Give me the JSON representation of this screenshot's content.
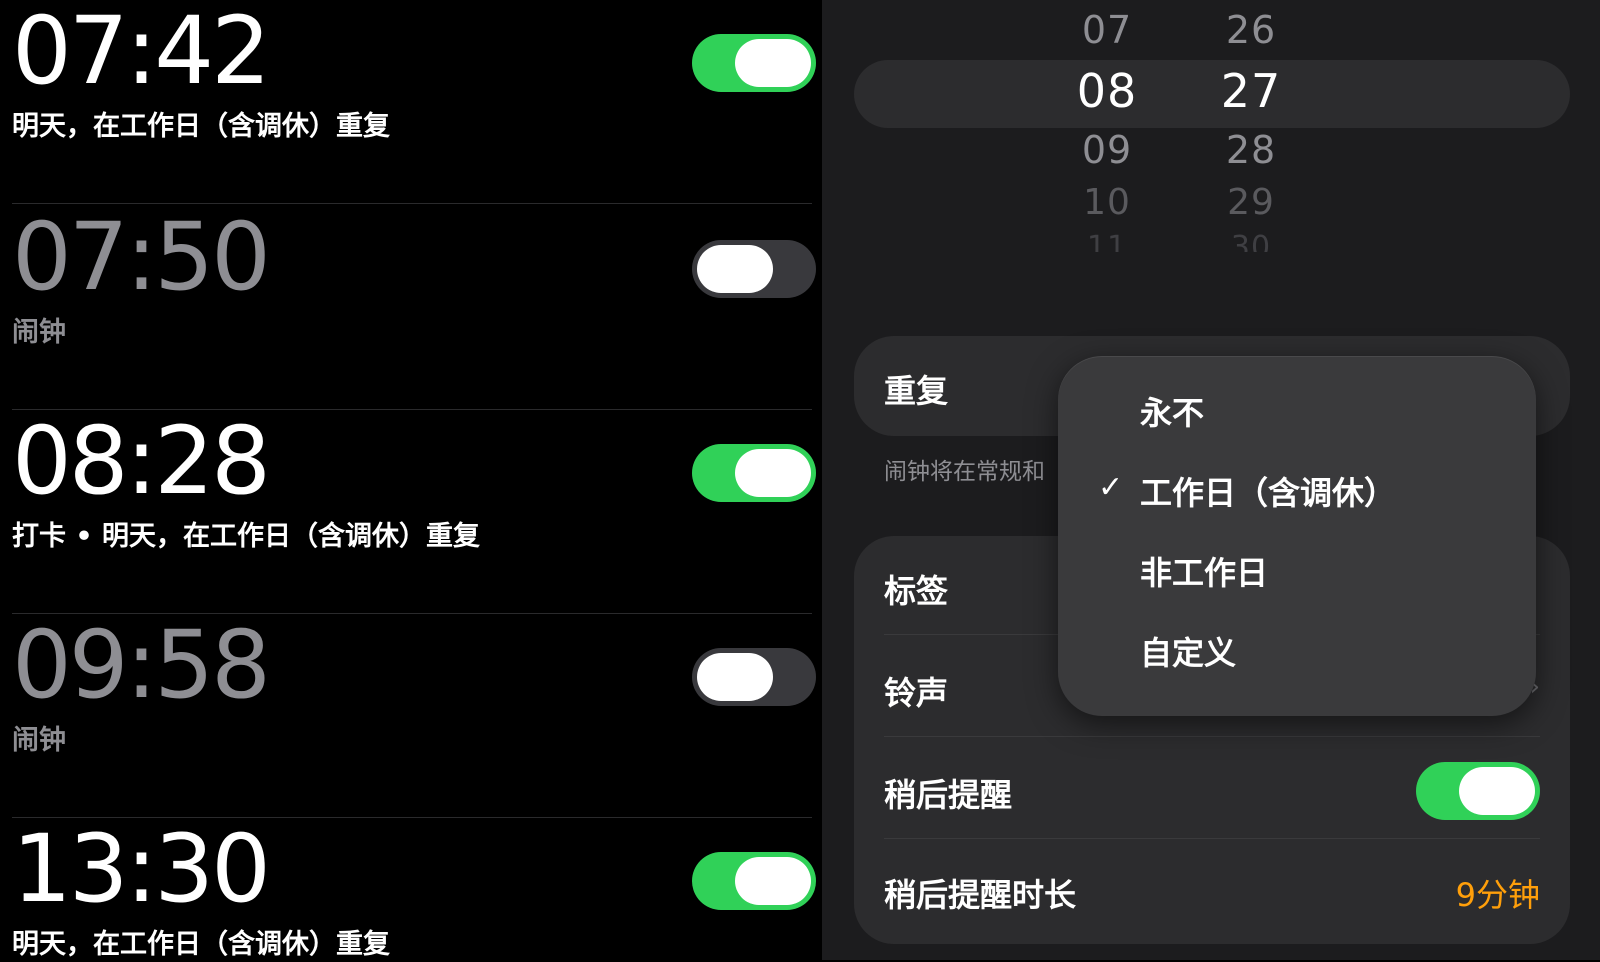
{
  "alarms": [
    {
      "time": "07:42",
      "subtitle": "明天，在工作日（含调休）重复",
      "enabled": true
    },
    {
      "time": "07:50",
      "subtitle": "闹钟",
      "enabled": false
    },
    {
      "time": "08:28",
      "subtitle": "打卡 • 明天，在工作日（含调休）重复",
      "enabled": true
    },
    {
      "time": "09:58",
      "subtitle": "闹钟",
      "enabled": false
    },
    {
      "time": "13:30",
      "subtitle": "明天，在工作日（含调休）重复",
      "enabled": true
    }
  ],
  "picker": {
    "hours": [
      "07",
      "08",
      "09",
      "10",
      "11"
    ],
    "minutes": [
      "26",
      "27",
      "28",
      "29",
      "30"
    ],
    "selected_hour": "08",
    "selected_minute": "27"
  },
  "editor": {
    "repeat_label": "重复",
    "note_text": "闹钟将在常规和",
    "label_label": "标签",
    "ringtone_label": "铃声",
    "snooze_label": "稍后提醒",
    "snooze_enabled": true,
    "snooze_duration_label": "稍后提醒时长",
    "snooze_duration_value": "9分钟"
  },
  "repeat_menu": {
    "options": [
      "永不",
      "工作日（含调休）",
      "非工作日",
      "自定义"
    ],
    "selected": "工作日（含调休）",
    "check_icon": "✓"
  },
  "colors": {
    "toggle_on": "#30d158",
    "toggle_off": "#39393d",
    "accent_orange": "#ff9f0a"
  }
}
